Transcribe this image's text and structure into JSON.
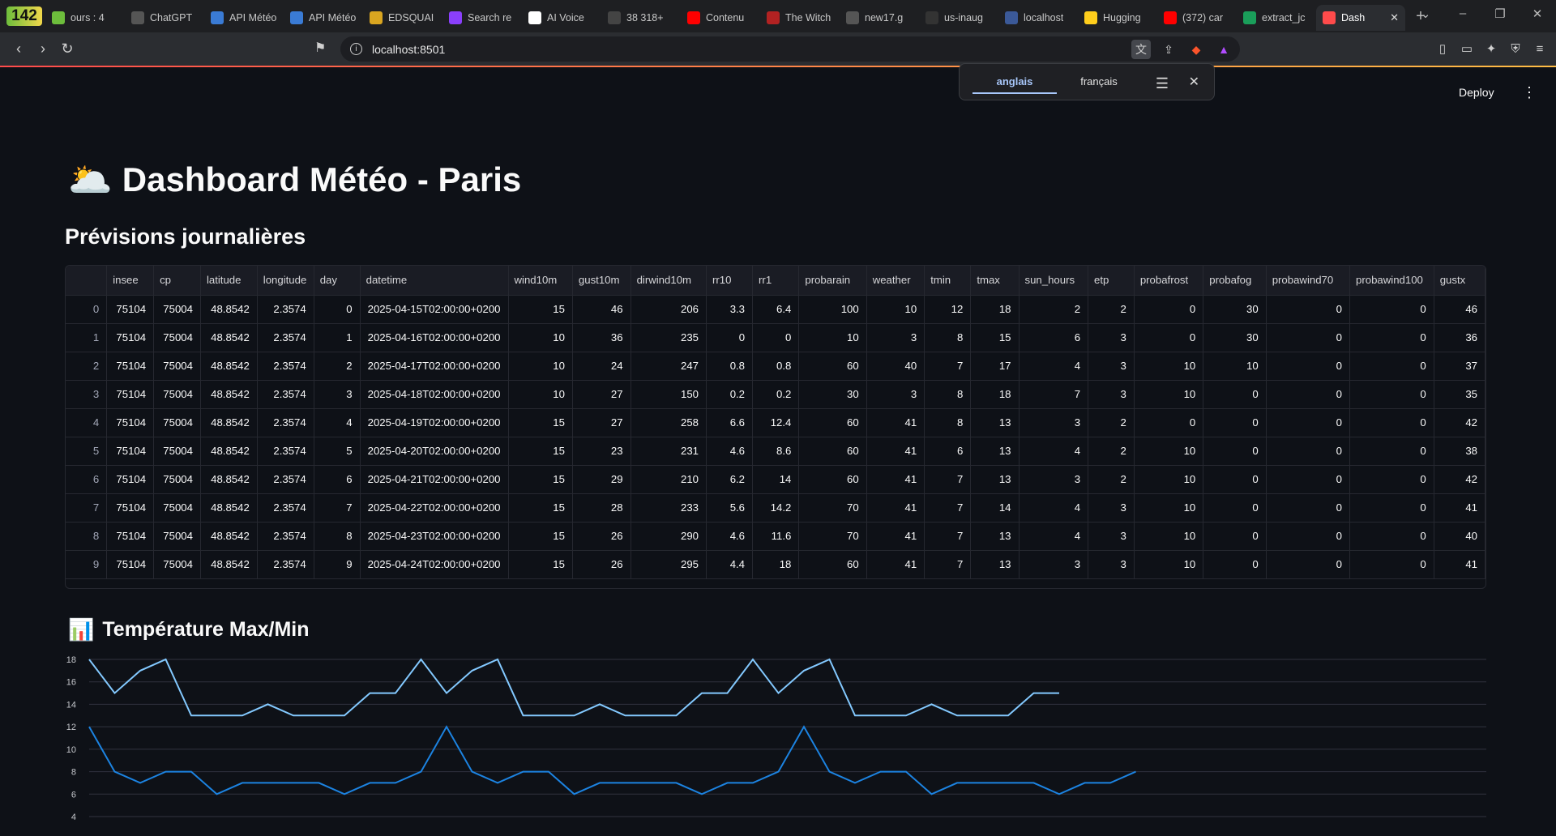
{
  "browser": {
    "tab_count": "142",
    "tabs": [
      {
        "label": "ours : 4",
        "icon": "tabs-count-icon"
      },
      {
        "label": "ChatGPT",
        "icon": "chatgpt-icon"
      },
      {
        "label": "API Météo",
        "icon": "weather-icon"
      },
      {
        "label": "API Météo",
        "icon": "weather-icon"
      },
      {
        "label": "EDSQUAI",
        "icon": "edsquai-icon"
      },
      {
        "label": "Search re",
        "icon": "search-icon"
      },
      {
        "label": "AI Voice",
        "icon": "ai-voice-icon"
      },
      {
        "label": "38 318+",
        "icon": "link-icon"
      },
      {
        "label": "Contenu",
        "icon": "youtube-icon"
      },
      {
        "label": "The Witch",
        "icon": "witch-icon"
      },
      {
        "label": "new17.g",
        "icon": "globe-icon"
      },
      {
        "label": "us-inaug",
        "icon": "github-icon"
      },
      {
        "label": "localhost",
        "icon": "localhost-icon"
      },
      {
        "label": "Hugging",
        "icon": "hugging-face-icon"
      },
      {
        "label": "(372) car",
        "icon": "youtube-icon"
      },
      {
        "label": "extract_jc",
        "icon": "extract-icon"
      },
      {
        "label": "Dash",
        "icon": "streamlit-icon",
        "active": true
      }
    ],
    "url": "localhost:8501",
    "translate": {
      "tab_source": "anglais",
      "tab_target": "français"
    }
  },
  "app": {
    "deploy_label": "Deploy",
    "menu_glyph": "⋮",
    "title_emoji": "🌥️",
    "title": "Dashboard Météo - Paris",
    "subtitle": "Prévisions journalières",
    "chart_emoji": "📊",
    "chart_title": "Température Max/Min"
  },
  "table": {
    "columns": [
      "",
      "insee",
      "cp",
      "latitude",
      "longitude",
      "day",
      "datetime",
      "wind10m",
      "gust10m",
      "dirwind10m",
      "rr10",
      "rr1",
      "probarain",
      "weather",
      "tmin",
      "tmax",
      "sun_hours",
      "etp",
      "probafrost",
      "probafog",
      "probawind70",
      "probawind100",
      "gustx"
    ],
    "rows": [
      [
        "0",
        "75104",
        "75004",
        "48.8542",
        "2.3574",
        "0",
        "2025-04-15T02:00:00+0200",
        "15",
        "46",
        "206",
        "3.3",
        "6.4",
        "100",
        "10",
        "12",
        "18",
        "2",
        "2",
        "0",
        "30",
        "0",
        "0",
        "46"
      ],
      [
        "1",
        "75104",
        "75004",
        "48.8542",
        "2.3574",
        "1",
        "2025-04-16T02:00:00+0200",
        "10",
        "36",
        "235",
        "0",
        "0",
        "10",
        "3",
        "8",
        "15",
        "6",
        "3",
        "0",
        "30",
        "0",
        "0",
        "36"
      ],
      [
        "2",
        "75104",
        "75004",
        "48.8542",
        "2.3574",
        "2",
        "2025-04-17T02:00:00+0200",
        "10",
        "24",
        "247",
        "0.8",
        "0.8",
        "60",
        "40",
        "7",
        "17",
        "4",
        "3",
        "10",
        "10",
        "0",
        "0",
        "37"
      ],
      [
        "3",
        "75104",
        "75004",
        "48.8542",
        "2.3574",
        "3",
        "2025-04-18T02:00:00+0200",
        "10",
        "27",
        "150",
        "0.2",
        "0.2",
        "30",
        "3",
        "8",
        "18",
        "7",
        "3",
        "10",
        "0",
        "0",
        "0",
        "35"
      ],
      [
        "4",
        "75104",
        "75004",
        "48.8542",
        "2.3574",
        "4",
        "2025-04-19T02:00:00+0200",
        "15",
        "27",
        "258",
        "6.6",
        "12.4",
        "60",
        "41",
        "8",
        "13",
        "3",
        "2",
        "0",
        "0",
        "0",
        "0",
        "42"
      ],
      [
        "5",
        "75104",
        "75004",
        "48.8542",
        "2.3574",
        "5",
        "2025-04-20T02:00:00+0200",
        "15",
        "23",
        "231",
        "4.6",
        "8.6",
        "60",
        "41",
        "6",
        "13",
        "4",
        "2",
        "10",
        "0",
        "0",
        "0",
        "38"
      ],
      [
        "6",
        "75104",
        "75004",
        "48.8542",
        "2.3574",
        "6",
        "2025-04-21T02:00:00+0200",
        "15",
        "29",
        "210",
        "6.2",
        "14",
        "60",
        "41",
        "7",
        "13",
        "3",
        "2",
        "10",
        "0",
        "0",
        "0",
        "42"
      ],
      [
        "7",
        "75104",
        "75004",
        "48.8542",
        "2.3574",
        "7",
        "2025-04-22T02:00:00+0200",
        "15",
        "28",
        "233",
        "5.6",
        "14.2",
        "70",
        "41",
        "7",
        "14",
        "4",
        "3",
        "10",
        "0",
        "0",
        "0",
        "41"
      ],
      [
        "8",
        "75104",
        "75004",
        "48.8542",
        "2.3574",
        "8",
        "2025-04-23T02:00:00+0200",
        "15",
        "26",
        "290",
        "4.6",
        "11.6",
        "70",
        "41",
        "7",
        "13",
        "4",
        "3",
        "10",
        "0",
        "0",
        "0",
        "40"
      ],
      [
        "9",
        "75104",
        "75004",
        "48.8542",
        "2.3574",
        "9",
        "2025-04-24T02:00:00+0200",
        "15",
        "26",
        "295",
        "4.4",
        "18",
        "60",
        "41",
        "7",
        "13",
        "3",
        "3",
        "10",
        "0",
        "0",
        "0",
        "41"
      ]
    ]
  },
  "chart_data": {
    "type": "line",
    "title": "Température Max/Min",
    "xlabel": "",
    "ylabel": "",
    "ylim": [
      4,
      18
    ],
    "yticks": [
      18,
      16,
      14,
      12,
      10,
      8,
      6,
      4
    ],
    "grid": true,
    "series": [
      {
        "color": "#83c9ff",
        "values": [
          18,
          15,
          17,
          18,
          13,
          13,
          13,
          14,
          13,
          13,
          13,
          15,
          15,
          18,
          15,
          17,
          18,
          13,
          13,
          13,
          14,
          13,
          13,
          13,
          15,
          15,
          18,
          15,
          17,
          18,
          13,
          13,
          13,
          14,
          13,
          13,
          13,
          15,
          15
        ]
      },
      {
        "color": "#1c83e1",
        "values": [
          12,
          8,
          7,
          8,
          8,
          6,
          7,
          7,
          7,
          7,
          6,
          7,
          7,
          8,
          12,
          8,
          7,
          8,
          8,
          6,
          7,
          7,
          7,
          7,
          6,
          7,
          7,
          8,
          12,
          8,
          7,
          8,
          8,
          6,
          7,
          7,
          7,
          7,
          6,
          7,
          7,
          8
        ]
      }
    ]
  }
}
